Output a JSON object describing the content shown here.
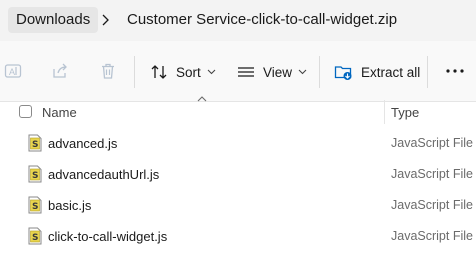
{
  "breadcrumb": {
    "items": [
      "Downloads",
      "Customer Service-click-to-call-widget.zip"
    ]
  },
  "toolbar": {
    "sort_label": "Sort",
    "view_label": "View",
    "extract_label": "Extract all",
    "more_label": "•••"
  },
  "header": {
    "name_label": "Name",
    "type_label": "Type"
  },
  "files": [
    {
      "name": "advanced.js",
      "type": "JavaScript File"
    },
    {
      "name": "advancedauthUrl.js",
      "type": "JavaScript File"
    },
    {
      "name": "basic.js",
      "type": "JavaScript File"
    },
    {
      "name": "click-to-call-widget.js",
      "type": "JavaScript File"
    }
  ],
  "colors": {
    "accent": "#0067c0",
    "file_icon_fill": "#e8d44d",
    "muted_icon": "#b8c4d2"
  }
}
